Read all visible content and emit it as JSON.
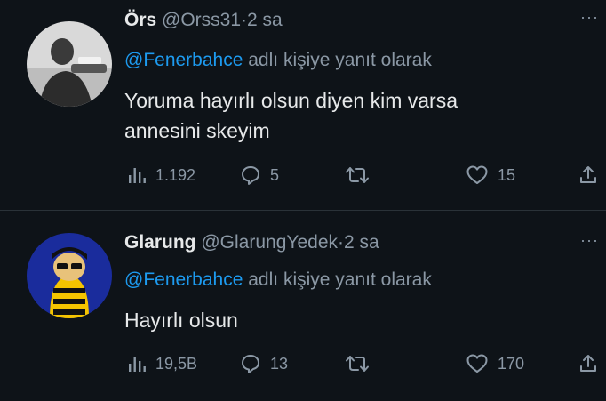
{
  "tweets": [
    {
      "display_name": "Örs",
      "handle": "@Orss31",
      "separator": "·",
      "time": "2 sa",
      "more_icon": "more-dots-icon",
      "reply_mention": "@Fenerbahce",
      "reply_suffix": "adlı kişiye yanıt olarak",
      "text_line_1": "Yoruma hayırlı olsun diyen kim varsa",
      "text_line_2": "annesini skeyim",
      "views": "1.192",
      "replies": "5",
      "retweets": "",
      "likes": "15"
    },
    {
      "display_name": "Glarung",
      "handle": "@GlarungYedek",
      "separator": "·",
      "time": "2 sa",
      "more_icon": "more-dots-icon",
      "reply_mention": "@Fenerbahce",
      "reply_suffix": "adlı kişiye yanıt olarak",
      "text_line_1": "Hayırlı olsun",
      "text_line_2": "",
      "views": "19,5B",
      "replies": "13",
      "retweets": "",
      "likes": "170"
    }
  ],
  "icons": {
    "views": "views-chart-icon",
    "reply": "reply-bubble-icon",
    "retweet": "retweet-icon",
    "like": "heart-icon",
    "share": "share-icon"
  },
  "colors": {
    "background": "#0f1419",
    "text": "#e7e9ea",
    "muted": "#8b98a5",
    "link": "#1d9bf0",
    "divider": "#2a3238"
  }
}
